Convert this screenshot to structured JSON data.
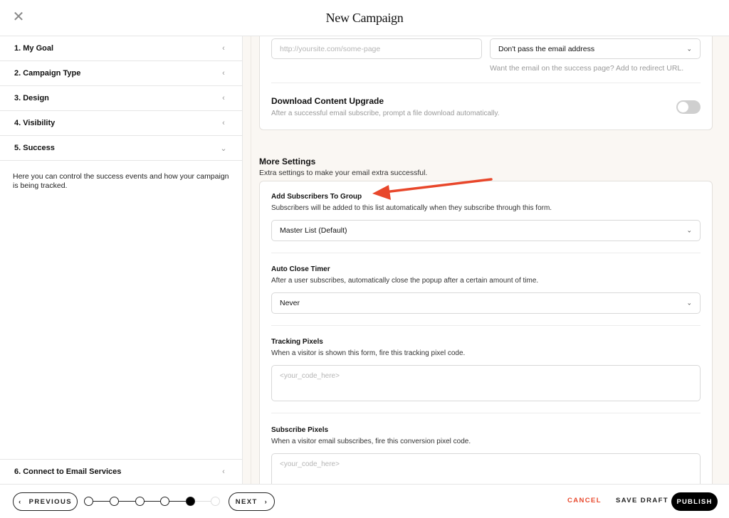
{
  "header": {
    "title": "New Campaign",
    "close_icon": "close-icon"
  },
  "sidebar": {
    "items": [
      {
        "label": "1. My Goal",
        "icon": "chevron-left-icon",
        "expanded": false
      },
      {
        "label": "2. Campaign Type",
        "icon": "chevron-left-icon",
        "expanded": false
      },
      {
        "label": "3. Design",
        "icon": "chevron-left-icon",
        "expanded": false
      },
      {
        "label": "4. Visibility",
        "icon": "chevron-left-icon",
        "expanded": false
      },
      {
        "label": "5. Success",
        "icon": "chevron-down-icon",
        "expanded": true
      }
    ],
    "active_description": "Here you can control the success events and how your campaign is being tracked.",
    "bottom_item": {
      "label": "6. Connect to Email Services",
      "icon": "chevron-left-icon",
      "expanded": false
    }
  },
  "main": {
    "redirect": {
      "url_placeholder": "http://yoursite.com/some-page",
      "email_pass_select": "Don't pass the email address",
      "email_pass_hint": "Want the email on the success page? Add to redirect URL."
    },
    "download_upgrade": {
      "title": "Download Content Upgrade",
      "description": "After a successful email subscribe, prompt a file download automatically.",
      "enabled": false
    },
    "more_settings": {
      "title": "More Settings",
      "description": "Extra settings to make your email extra successful.",
      "add_to_group": {
        "label": "Add Subscribers To Group",
        "description": "Subscribers will be added to this list automatically when they subscribe through this form.",
        "selected": "Master List (Default)"
      },
      "auto_close": {
        "label": "Auto Close Timer",
        "description": "After a user subscribes, automatically close the popup after a certain amount of time.",
        "selected": "Never"
      },
      "tracking_pixels": {
        "label": "Tracking Pixels",
        "description": "When a visitor is shown this form, fire this tracking pixel code.",
        "placeholder": "<your_code_here>"
      },
      "subscribe_pixels": {
        "label": "Subscribe Pixels",
        "description": "When a visitor email subscribes, fire this conversion pixel code.",
        "placeholder": "<your_code_here>"
      }
    }
  },
  "annotation": {
    "type": "arrow",
    "color": "#e8472b",
    "points_to": "Add Subscribers To Group"
  },
  "footer": {
    "previous_label": "PREVIOUS",
    "next_label": "NEXT",
    "steps_total": 6,
    "current_step": 5,
    "cancel_label": "CANCEL",
    "save_draft_label": "SAVE DRAFT",
    "publish_label": "PUBLISH",
    "cancel_color": "#e8472b"
  }
}
